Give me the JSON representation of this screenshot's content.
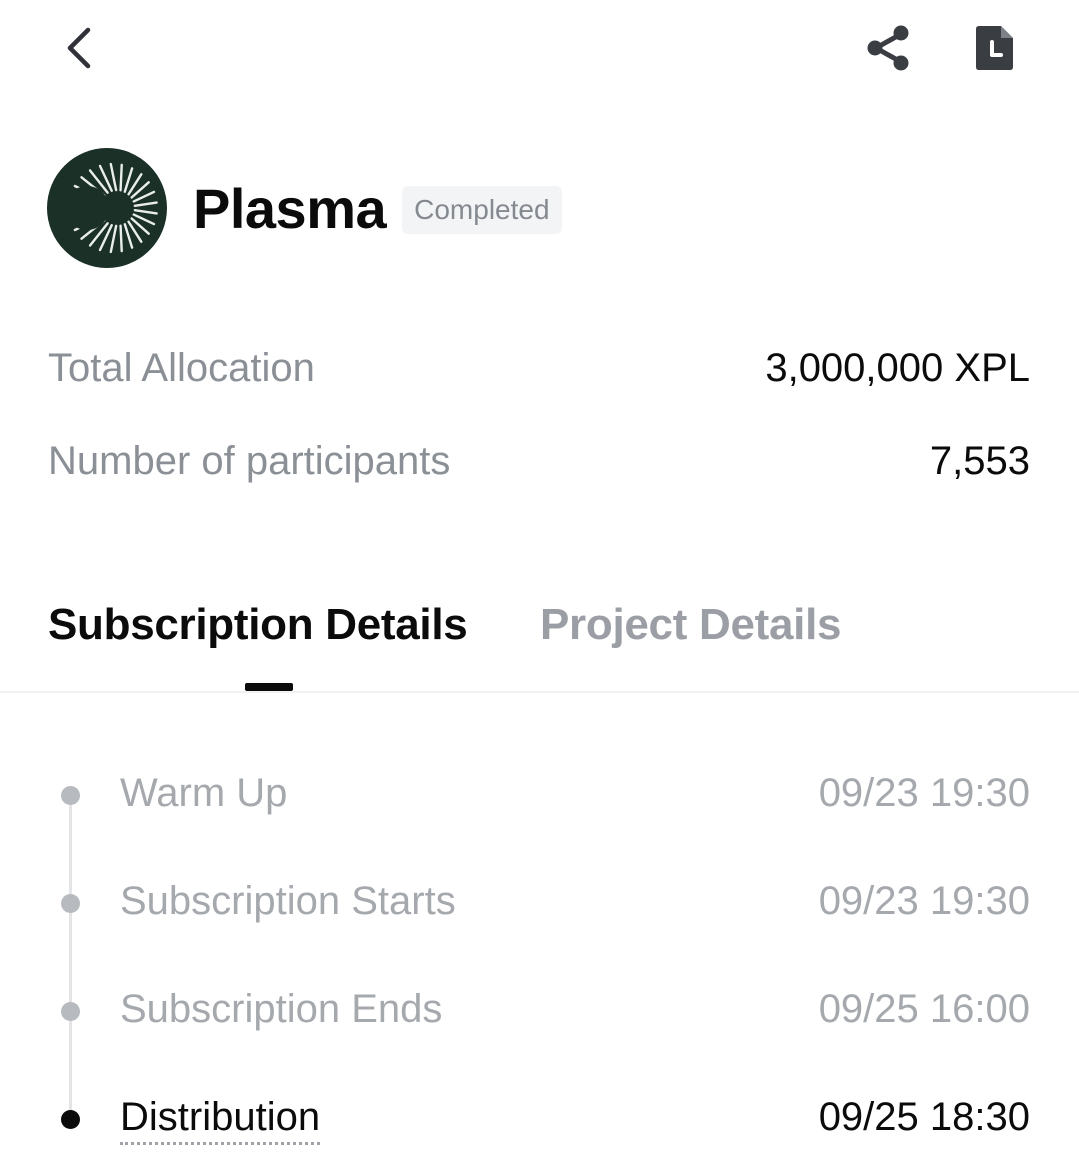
{
  "icons": {
    "back": "chevron-left-icon",
    "share": "share-icon",
    "history": "document-clock-icon",
    "logo": "plasma-logo"
  },
  "colors": {
    "logo_bg": "#1b3027",
    "badge_bg": "#f3f4f5",
    "muted_text": "#8b9096",
    "primary_text": "#0b0b0b"
  },
  "project": {
    "name": "Plasma",
    "status": "Completed"
  },
  "stats": [
    {
      "label": "Total Allocation",
      "value": "3,000,000 XPL"
    },
    {
      "label": "Number of participants",
      "value": "7,553"
    }
  ],
  "tabs": [
    {
      "label": "Subscription Details",
      "active": true
    },
    {
      "label": "Project Details",
      "active": false
    }
  ],
  "timeline": [
    {
      "label": "Warm Up",
      "time": "09/23 19:30",
      "current": false
    },
    {
      "label": "Subscription Starts",
      "time": "09/23 19:30",
      "current": false
    },
    {
      "label": "Subscription Ends",
      "time": "09/25 16:00",
      "current": false
    },
    {
      "label": "Distribution",
      "time": "09/25 18:30",
      "current": true
    }
  ]
}
